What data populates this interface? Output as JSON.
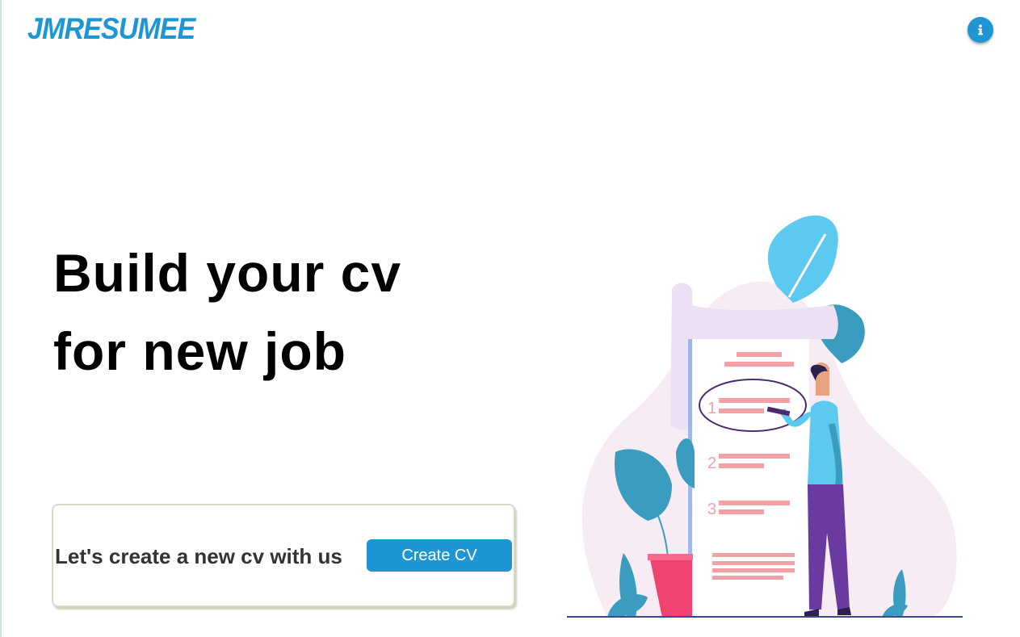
{
  "header": {
    "logo_text": "JMRESUMEE",
    "info_icon": "info-icon"
  },
  "hero": {
    "title_line1": "Build your cv",
    "title_line2": "for new job"
  },
  "cta": {
    "text": "Let's create a new cv with us",
    "button_label": "Create CV"
  },
  "illustration": {
    "list_numbers": [
      "1",
      "2",
      "3"
    ]
  },
  "colors": {
    "accent": "#1e96d4",
    "card_border": "#d7d9c7"
  }
}
